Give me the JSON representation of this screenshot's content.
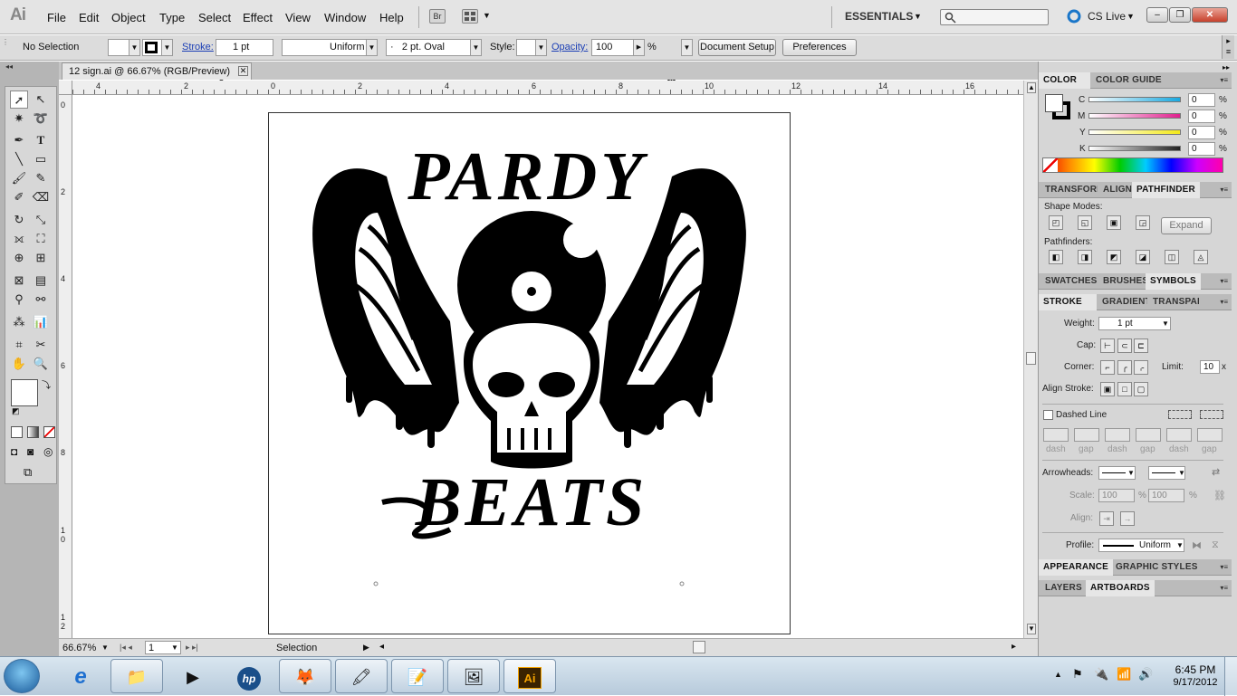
{
  "app": {
    "logo": "Ai"
  },
  "menu": [
    "File",
    "Edit",
    "Object",
    "Type",
    "Select",
    "Effect",
    "View",
    "Window",
    "Help"
  ],
  "menubar_right": {
    "bridge": "Br",
    "workspace": "ESSENTIALS",
    "cs_live": "CS Live"
  },
  "window_controls": {
    "minimize": "–",
    "restore": "❐",
    "close": "✕"
  },
  "controlbar": {
    "selection": "No Selection",
    "stroke_label": "Stroke:",
    "stroke_weight": "1 pt",
    "stroke_profile": "Uniform",
    "brush": "2 pt. Oval",
    "brush_dot": "·",
    "style_label": "Style:",
    "opacity_label": "Opacity:",
    "opacity_value": "100",
    "opacity_unit": "%",
    "document_setup": "Document Setup",
    "preferences": "Preferences"
  },
  "document": {
    "tab_title": "12 sign.ai @ 66.67% (RGB/Preview)",
    "ruler_top": [
      "4",
      "2",
      "0",
      "2",
      "4",
      "6",
      "8",
      "10",
      "12",
      "14",
      "16"
    ],
    "ruler_left": [
      "0",
      "2",
      "4",
      "6",
      "8",
      "1\n0",
      "1\n2"
    ],
    "artwork_top_text": "PARDY",
    "artwork_bottom_text": "BEATS",
    "zoom": "66.67%",
    "artboard_number": "1",
    "status": "Selection"
  },
  "color_panel": {
    "tabs": [
      "COLOR",
      "COLOR GUIDE"
    ],
    "channels": [
      {
        "name": "C",
        "value": "0",
        "unit": "%",
        "color": "#19a9e0"
      },
      {
        "name": "M",
        "value": "0",
        "unit": "%",
        "color": "#e0208e"
      },
      {
        "name": "Y",
        "value": "0",
        "unit": "%",
        "color": "#f2e81a"
      },
      {
        "name": "K",
        "value": "0",
        "unit": "%",
        "color": "#222222"
      }
    ]
  },
  "pathfinder_panel": {
    "tabs": [
      "TRANSFORM",
      "ALIGN",
      "PATHFINDER"
    ],
    "shape_modes": "Shape Modes:",
    "expand": "Expand",
    "pathfinders": "Pathfinders:"
  },
  "swatches_tabs": [
    "SWATCHES",
    "BRUSHES",
    "SYMBOLS"
  ],
  "stroke_panel": {
    "tabs": [
      "STROKE",
      "GRADIENT",
      "TRANSPARENCY"
    ],
    "weight_label": "Weight:",
    "weight_value": "1 pt",
    "cap_label": "Cap:",
    "corner_label": "Corner:",
    "limit_label": "Limit:",
    "limit_value": "10",
    "limit_unit": "x",
    "align_label": "Align Stroke:",
    "dashed_label": "Dashed Line",
    "dash_labels": [
      "dash",
      "gap",
      "dash",
      "gap",
      "dash",
      "gap"
    ],
    "arrowheads_label": "Arrowheads:",
    "scale_label": "Scale:",
    "scale_1": "100",
    "scale_2": "100",
    "percent": "%",
    "align_arrows_label": "Align:",
    "profile_label": "Profile:",
    "profile_value": "Uniform"
  },
  "bottom_tabs_1": [
    "APPEARANCE",
    "GRAPHIC STYLES"
  ],
  "bottom_tabs_2": [
    "LAYERS",
    "ARTBOARDS"
  ],
  "taskbar": {
    "time": "6:45 PM",
    "date": "9/17/2012",
    "hp": "hp",
    "ai": "Ai"
  }
}
